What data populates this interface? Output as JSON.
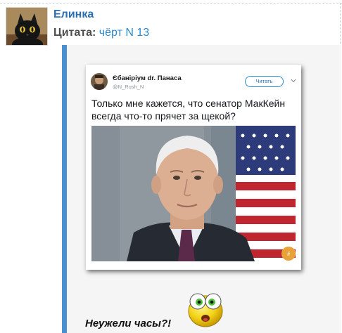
{
  "post": {
    "author": "Елинка",
    "quote_label": "Цитата:",
    "quote_author": "чёрт N 13",
    "reply_text": "Неужели часы?!"
  },
  "tweet": {
    "display_name": "Єбаніріум dr. Панаса",
    "handle": "@N_Rush_N",
    "follow_label": "Читать",
    "text": "Только мне кажется, что сенатор МакКейн всегда что-то прячет за щекой?"
  },
  "icons": {
    "avatar": "black-cat-avatar",
    "tweet_menu": "chevron-down-icon",
    "emoticon": "surprised-smiley-icon",
    "photo_badge": "sticker-logo"
  },
  "colors": {
    "username": "#2a6fb5",
    "quote_author": "#2a8ad0",
    "quote_bar": "#4a8fd0",
    "quote_background": "#f5f5f5"
  }
}
